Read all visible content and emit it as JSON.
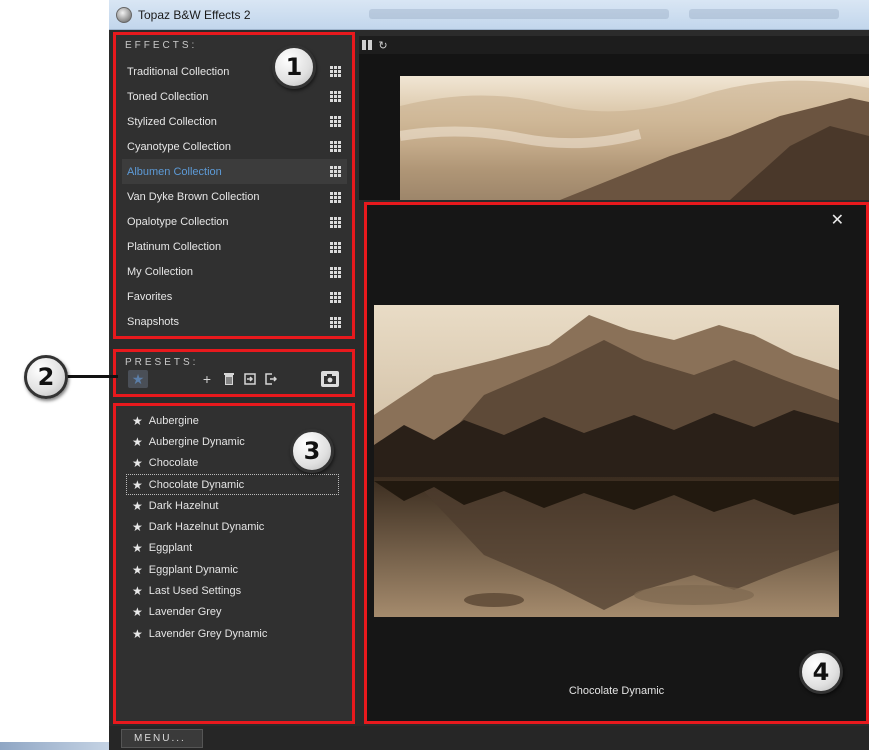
{
  "window": {
    "title": "Topaz B&W Effects 2"
  },
  "effects": {
    "header": "EFFECTS:",
    "items": [
      {
        "label": "Traditional Collection",
        "active": false
      },
      {
        "label": "Toned Collection",
        "active": false
      },
      {
        "label": "Stylized Collection",
        "active": false
      },
      {
        "label": "Cyanotype Collection",
        "active": false
      },
      {
        "label": "Albumen Collection",
        "active": true
      },
      {
        "label": "Van Dyke Brown Collection",
        "active": false
      },
      {
        "label": "Opalotype Collection",
        "active": false
      },
      {
        "label": "Platinum Collection",
        "active": false
      },
      {
        "label": "My Collection",
        "active": false
      },
      {
        "label": "Favorites",
        "active": false
      },
      {
        "label": "Snapshots",
        "active": false
      }
    ]
  },
  "presets": {
    "header": "PRESETS:",
    "tools": [
      "favorite-star",
      "add",
      "delete",
      "import",
      "export",
      "snapshot-camera"
    ]
  },
  "preset_list": {
    "items": [
      {
        "label": "Aubergine",
        "selected": false
      },
      {
        "label": "Aubergine Dynamic",
        "selected": false
      },
      {
        "label": "Chocolate",
        "selected": false
      },
      {
        "label": "Chocolate Dynamic",
        "selected": true
      },
      {
        "label": "Dark Hazelnut",
        "selected": false
      },
      {
        "label": "Dark Hazelnut Dynamic",
        "selected": false
      },
      {
        "label": "Eggplant",
        "selected": false
      },
      {
        "label": "Eggplant Dynamic",
        "selected": false
      },
      {
        "label": "Last Used Settings",
        "selected": false
      },
      {
        "label": "Lavender Grey",
        "selected": false
      },
      {
        "label": "Lavender Grey Dynamic",
        "selected": false
      }
    ]
  },
  "preview": {
    "caption": "Chocolate Dynamic",
    "close_glyph": "✕"
  },
  "callouts": [
    "1",
    "2",
    "3",
    "4"
  ],
  "menu": {
    "label": "MENU..."
  },
  "colors": {
    "annotation_red": "#e8191d",
    "active_blue": "#5d9ad6",
    "panel_bg": "#303030"
  }
}
